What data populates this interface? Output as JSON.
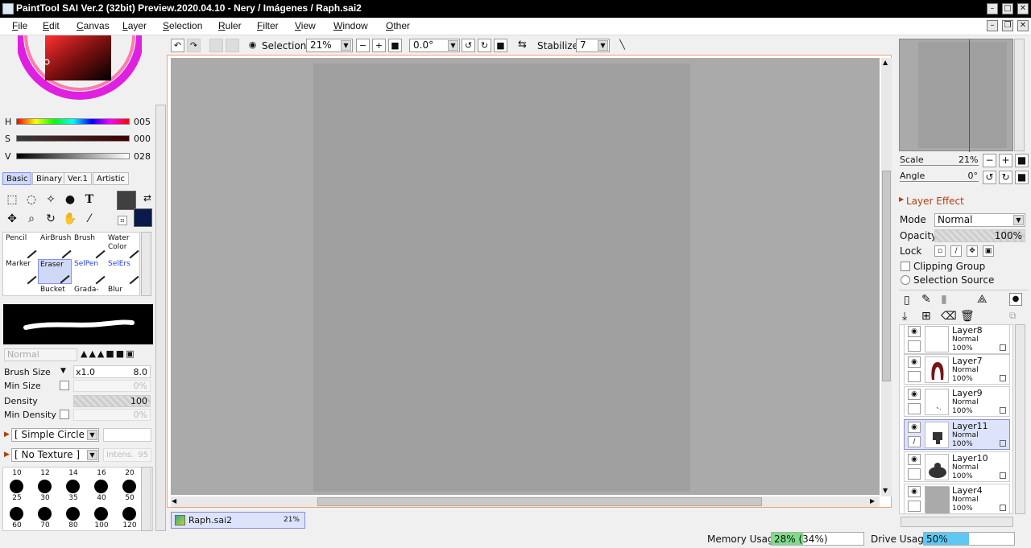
{
  "title": "PaintTool SAI Ver.2 (32bit) Preview.2020.04.10 - Nery / Imágenes / Raph.sai2",
  "menu": [
    "File",
    "Edit",
    "Canvas",
    "Layer",
    "Selection",
    "Ruler",
    "Filter",
    "View",
    "Window",
    "Other"
  ],
  "color": {
    "h_label": "H",
    "h_value": "005",
    "s_label": "S",
    "s_value": "000",
    "v_label": "V",
    "v_value": "028",
    "primary": "#404040",
    "secondary": "#0a1a4a"
  },
  "palette_tabs": [
    "Basic",
    "Binary",
    "Ver.1",
    "Artistic"
  ],
  "brushes": [
    {
      "label": "Pencil",
      "icon": "pencil-icon"
    },
    {
      "label": "AirBrush",
      "icon": "airbrush-icon"
    },
    {
      "label": "Brush",
      "icon": "brush-icon"
    },
    {
      "label": "Water Color",
      "icon": "watercolor-icon"
    },
    {
      "label": "Marker",
      "icon": "marker-icon"
    },
    {
      "label": "Eraser",
      "icon": "eraser-icon"
    },
    {
      "label": "SelPen",
      "icon": "selpen-icon"
    },
    {
      "label": "SelErs",
      "icon": "selers-icon"
    },
    {
      "label": "Bucket",
      "icon": "bucket-icon"
    },
    {
      "label": "Grada-",
      "icon": "gradation-icon"
    },
    {
      "label": "Blur",
      "icon": "blur-icon"
    }
  ],
  "brush_settings": {
    "blend_mode": "Normal",
    "size_label": "Brush Size",
    "size_mult": "x1.0",
    "size_value": "8.0",
    "min_size_label": "Min Size",
    "min_size_value": "0%",
    "density_label": "Density",
    "density_value": "100",
    "min_density_label": "Min Density",
    "min_density_value": "0%",
    "shape": "[ Simple Circle ]",
    "texture": "[ No Texture ]",
    "intensity_label": "Intens.",
    "intensity_value": "95"
  },
  "brush_sizes": [
    "10",
    "12",
    "14",
    "16",
    "20",
    "25",
    "30",
    "35",
    "40",
    "50",
    "60",
    "70",
    "80",
    "100",
    "120"
  ],
  "toolbar": {
    "selection_label": "Selection",
    "zoom": "21%",
    "angle": "0.0°",
    "stabilizer_label": "Stabilizer",
    "stabilizer_value": "7"
  },
  "doc_tab": {
    "name": "Raph.sai2",
    "zoom": "21%"
  },
  "navigator": {
    "scale_label": "Scale",
    "scale_value": "21%",
    "angle_label": "Angle",
    "angle_value": "0°"
  },
  "layer_panel": {
    "effect_label": "Layer Effect",
    "mode_label": "Mode",
    "mode_value": "Normal",
    "opacity_label": "Opacity",
    "opacity_value": "100%",
    "lock_label": "Lock",
    "clipping_label": "Clipping Group",
    "selection_source_label": "Selection Source"
  },
  "layers": [
    {
      "name": "Layer8",
      "mode": "Normal",
      "opacity": "100%"
    },
    {
      "name": "Layer7",
      "mode": "Normal",
      "opacity": "100%"
    },
    {
      "name": "Layer9",
      "mode": "Normal",
      "opacity": "100%"
    },
    {
      "name": "Layer11",
      "mode": "Normal",
      "opacity": "100%"
    },
    {
      "name": "Layer10",
      "mode": "Normal",
      "opacity": "100%"
    },
    {
      "name": "Layer4",
      "mode": "Normal",
      "opacity": "100%"
    }
  ],
  "status": {
    "memory_label": "Memory Usage",
    "memory_value": "28% (34%)",
    "memory_fraction": 0.34,
    "drive_label": "Drive Usage",
    "drive_value": "50%",
    "drive_fraction": 0.5
  }
}
